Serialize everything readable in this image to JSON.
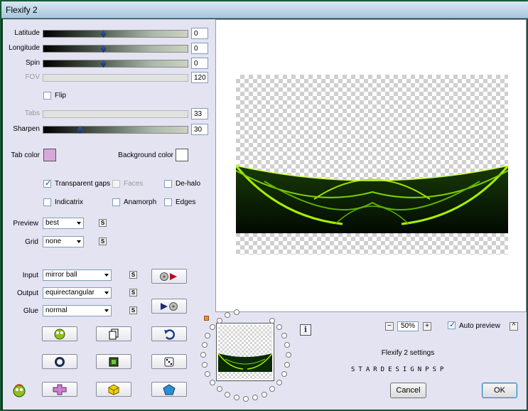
{
  "window": {
    "title": "Flexify 2"
  },
  "sliders": [
    {
      "label": "Latitude",
      "value": "0",
      "disabled": false,
      "pos": 0.41
    },
    {
      "label": "Longitude",
      "value": "0",
      "disabled": false,
      "pos": 0.41
    },
    {
      "label": "Spin",
      "value": "0",
      "disabled": false,
      "pos": 0.41
    },
    {
      "label": "FOV",
      "value": "120",
      "disabled": true,
      "pos": 0
    },
    {
      "label": "Tabs",
      "value": "33",
      "disabled": true,
      "pos": 0
    },
    {
      "label": "Sharpen",
      "value": "30",
      "disabled": false,
      "pos": 0.25
    }
  ],
  "flip": {
    "label": "Flip",
    "checked": false
  },
  "tab_color": {
    "label": "Tab color",
    "color": "#d9a8db"
  },
  "background_color": {
    "label": "Background color",
    "color": "#ffffff"
  },
  "options": {
    "transparent_gaps": {
      "label": "Transparent gaps",
      "checked": true
    },
    "faces": {
      "label": "Faces",
      "checked": false
    },
    "de_halo": {
      "label": "De-halo",
      "checked": false
    },
    "indicatrix": {
      "label": "Indicatrix",
      "checked": false
    },
    "anamorph": {
      "label": "Anamorph",
      "checked": false
    },
    "edges": {
      "label": "Edges",
      "checked": false
    }
  },
  "preview": {
    "label": "Preview",
    "value": "best"
  },
  "grid": {
    "label": "Grid",
    "value": "none"
  },
  "input": {
    "label": "Input",
    "value": "mirror ball"
  },
  "output": {
    "label": "Output",
    "value": "equirectangular"
  },
  "glue": {
    "label": "Glue",
    "value": "normal"
  },
  "s_badge": "S",
  "zoom": {
    "value": "50%",
    "minus": "−",
    "plus": "+"
  },
  "auto_preview": {
    "label": "Auto preview",
    "checked": true
  },
  "collapse": "^",
  "settings_name": "Flexify 2 settings",
  "signature": "STARDESIGNPSP",
  "buttons": {
    "cancel": "Cancel",
    "ok": "OK"
  },
  "info": "i",
  "colors": {
    "neon": "#9fe000",
    "dark": "#0a2a06"
  }
}
